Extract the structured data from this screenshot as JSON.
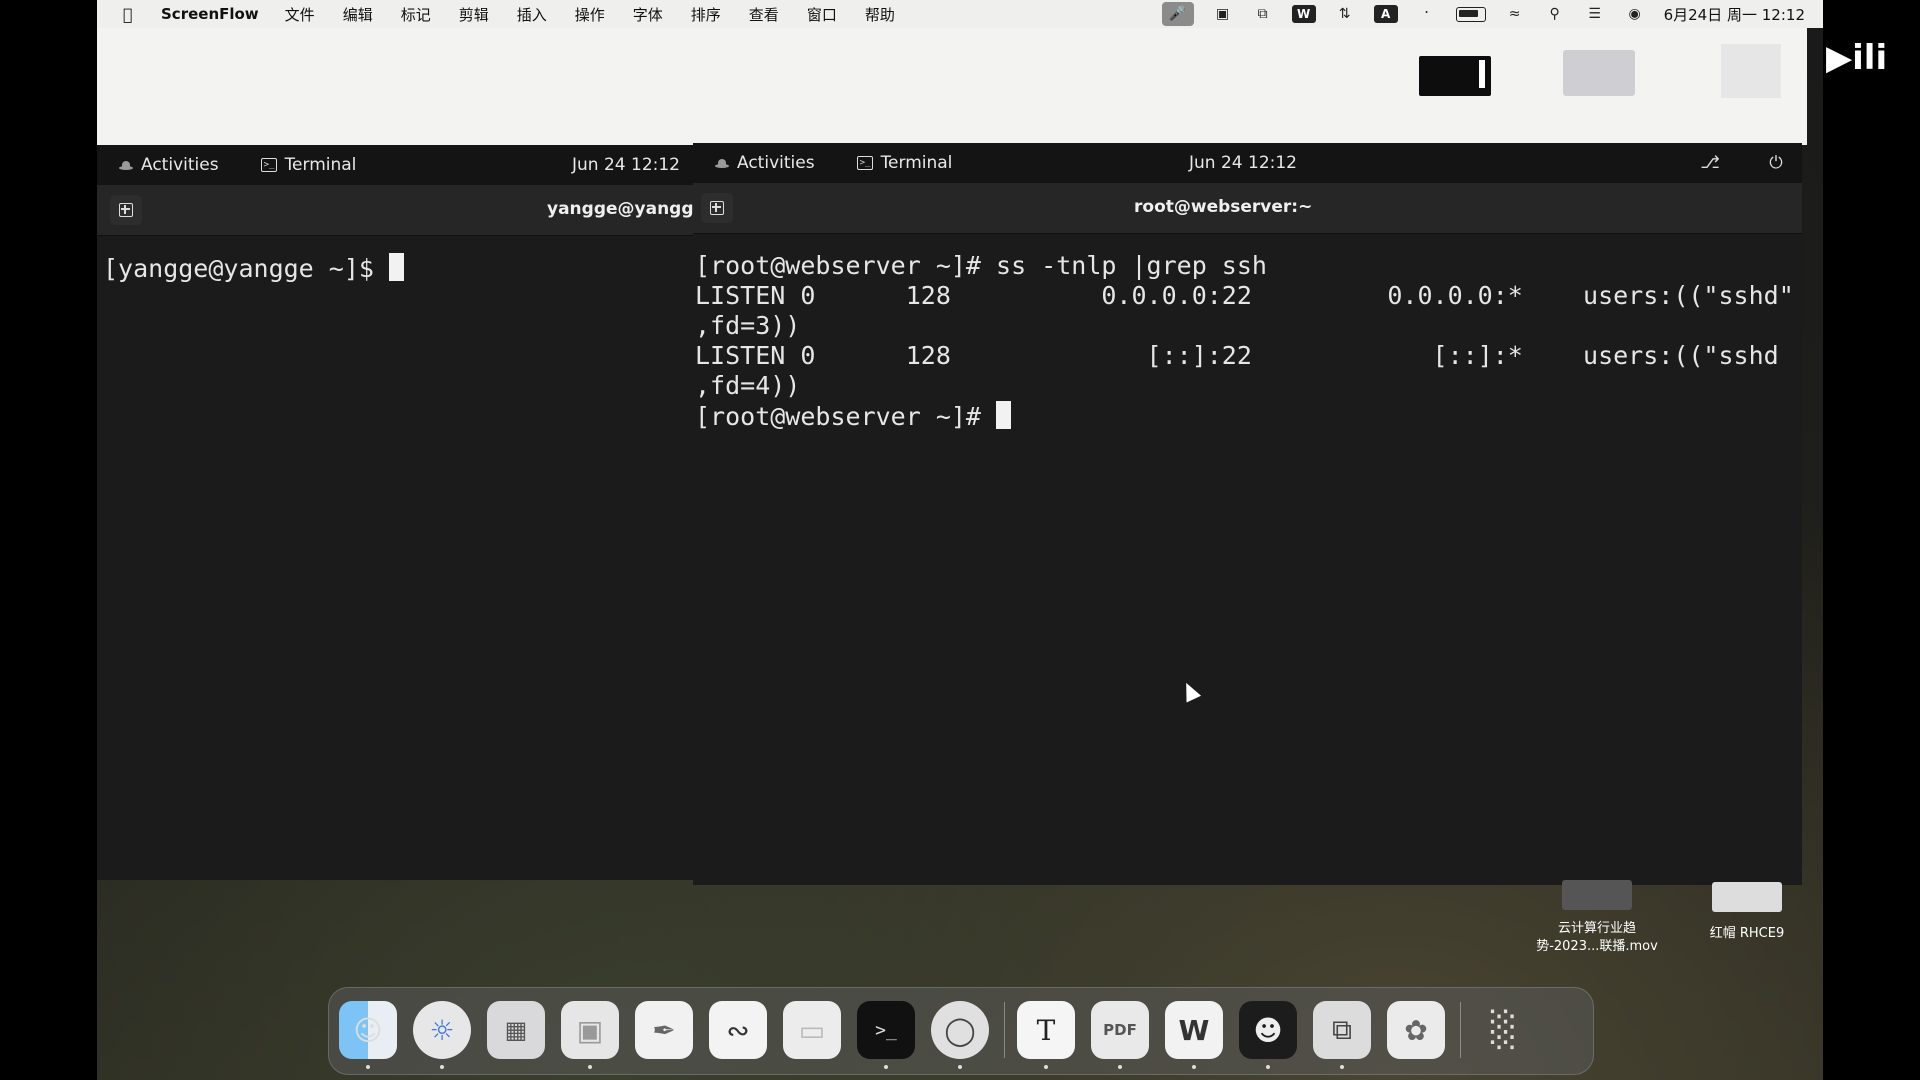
{
  "mac_menubar": {
    "app_name": "ScreenFlow",
    "menus": [
      "文件",
      "编辑",
      "标记",
      "剪辑",
      "插入",
      "操作",
      "字体",
      "排序",
      "查看",
      "窗口",
      "帮助"
    ],
    "input_indicator": "A",
    "clock": "6月24日 周一  12:12"
  },
  "vm_left": {
    "activities": "Activities",
    "app": "Terminal",
    "date": "Jun 24  12:12",
    "tab_title": "yangge@yangge:",
    "lines": [
      "[yangge@yangge ~]$ "
    ]
  },
  "vm_right": {
    "activities": "Activities",
    "app": "Terminal",
    "date": "Jun 24  12:12",
    "tab_title": "root@webserver:~",
    "lines": [
      "[root@webserver ~]# ss -tnlp |grep ssh",
      "LISTEN 0      128          0.0.0.0:22         0.0.0.0:*    users:((\"sshd\"",
      ",fd=3))",
      "LISTEN 0      128             [::]:22            [::]:*    users:((\"sshd",
      ",fd=4))",
      "[root@webserver ~]# "
    ]
  },
  "desktop_files": [
    {
      "name": "云计算行业趋\n势-2023...联播.mov"
    },
    {
      "name": "红帽 RHCE9"
    }
  ],
  "dock": {
    "items": [
      "finder-icon",
      "safari-icon",
      "launchpad-icon",
      "messages-icon",
      "notes-icon",
      "freeform-icon",
      "files-icon",
      "terminal-icon",
      "screenflow-icon",
      "typora-icon",
      "pdf-icon",
      "wps-icon",
      "chatbot-icon",
      "vm-icon",
      "photos-icon",
      "trash-icon"
    ],
    "pdf_label": "PDF",
    "typora_label": "T"
  },
  "colors": {
    "terminal_bg": "#1b1b1b",
    "terminal_fg": "#e6e6e6",
    "gnome_bar": "#141414",
    "menubar": "#efefed"
  }
}
